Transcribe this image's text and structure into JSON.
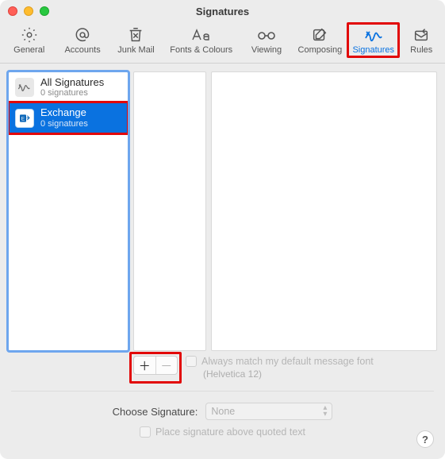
{
  "window": {
    "title": "Signatures"
  },
  "toolbar": {
    "items": [
      {
        "label": "General"
      },
      {
        "label": "Accounts"
      },
      {
        "label": "Junk Mail"
      },
      {
        "label": "Fonts & Colours"
      },
      {
        "label": "Viewing"
      },
      {
        "label": "Composing"
      },
      {
        "label": "Signatures"
      },
      {
        "label": "Rules"
      }
    ]
  },
  "accounts": {
    "items": [
      {
        "name": "All Signatures",
        "sub": "0 signatures"
      },
      {
        "name": "Exchange",
        "sub": "0 signatures"
      }
    ]
  },
  "options": {
    "match_font_label": "Always match my default message font",
    "font_note": "(Helvetica 12)"
  },
  "choose": {
    "label": "Choose Signature:",
    "selected": "None"
  },
  "place_above": {
    "label": "Place signature above quoted text"
  },
  "help": {
    "label": "?"
  }
}
